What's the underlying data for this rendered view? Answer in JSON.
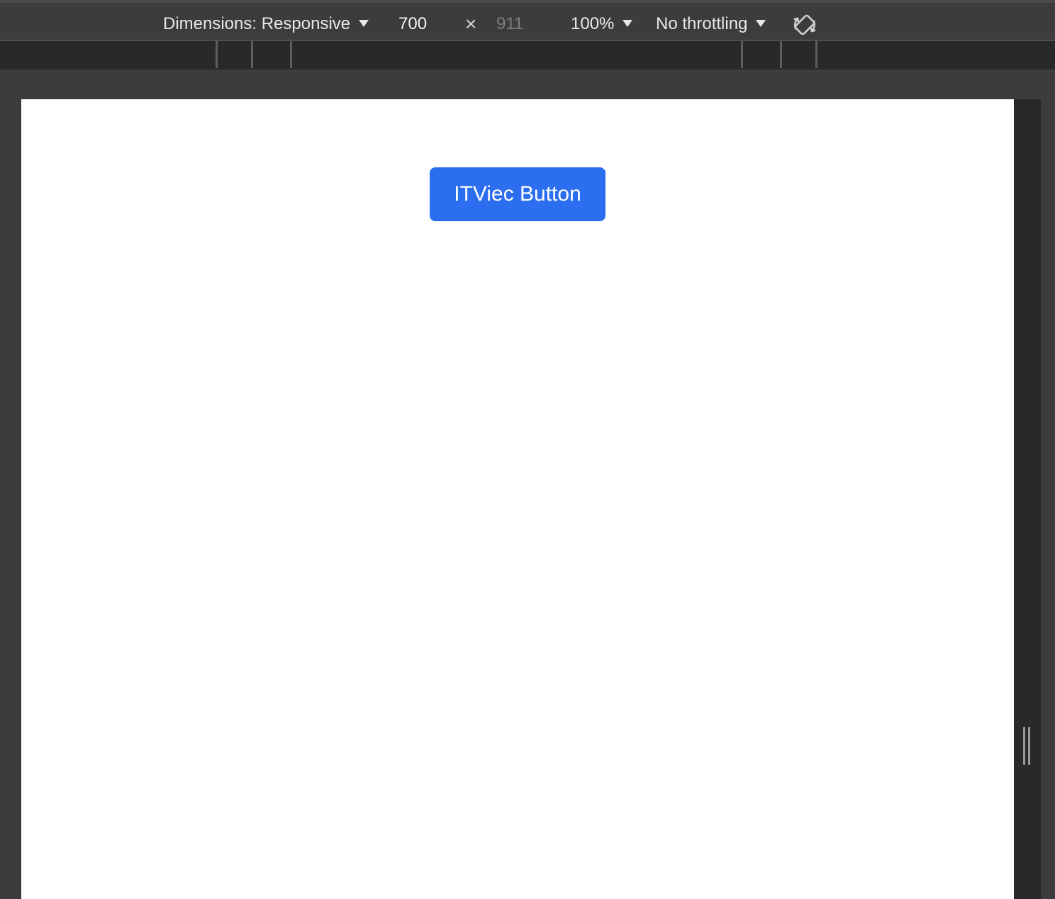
{
  "toolbar": {
    "dimensions_label": "Dimensions: Responsive",
    "width_value": "700",
    "times_glyph": "×",
    "height_placeholder": "911",
    "zoom_label": "100%",
    "throttling_label": "No throttling",
    "icons": {
      "dimensions_dropdown": "chevron-down-icon",
      "rotate": "rotate-icon"
    }
  },
  "page": {
    "button_label": "ITViec Button"
  },
  "colors": {
    "toolbar_bg": "#3c3c3c",
    "ruler_bg": "#28292b",
    "page_bg": "#ffffff",
    "button_bg": "#2b6ff0",
    "button_text": "#ffffff"
  }
}
